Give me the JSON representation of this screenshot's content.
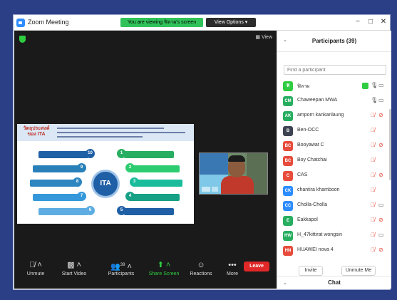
{
  "window": {
    "title": "Zoom Meeting",
    "share_banner": "You are viewing ฟิลาผ's screen",
    "view_options": "View Options",
    "minimize": "−",
    "maximize": "□",
    "close": "✕"
  },
  "video": {
    "view_label": "View",
    "slide_title": "วัตถุประสงค์ ของ ITA",
    "slide_center": "ITA",
    "slide_nodes": [
      "10",
      "1",
      "9",
      "2",
      "8",
      "3",
      "7",
      "4",
      "6",
      "5"
    ]
  },
  "toolbar": {
    "unmute": "Unmute",
    "start_video": "Start Video",
    "participants": "Participants",
    "participants_count": "39",
    "share_screen": "Share Screen",
    "reactions": "Reactions",
    "more": "More",
    "leave": "Leave"
  },
  "panel": {
    "title": "Participants (39)",
    "search_placeholder": "Find a participant",
    "invite": "Invite",
    "unmute_me": "Unmute Me",
    "chat": "Chat"
  },
  "participants": [
    {
      "initials": "ฟิ",
      "name": "ฟิลาผ",
      "color": "#2ecc40",
      "host": true,
      "mic": "on",
      "cam": "on"
    },
    {
      "initials": "CM",
      "name": "Chaweepan MWA",
      "color": "#27ae60",
      "host": false,
      "mic": "on",
      "cam": "on"
    },
    {
      "initials": "AK",
      "name": "amporn kankanlaung",
      "color": "#27ae60",
      "host": false,
      "mic": "muted",
      "cam": "off"
    },
    {
      "initials": "B",
      "name": "Ben-OCC",
      "color": "#3d4451",
      "host": false,
      "mic": "muted",
      "cam": "none"
    },
    {
      "initials": "BC",
      "name": "Booyawat C",
      "color": "#e74c3c",
      "host": false,
      "mic": "muted",
      "cam": "off"
    },
    {
      "initials": "BC",
      "name": "Boy Chatchai",
      "color": "#e74c3c",
      "host": false,
      "mic": "muted",
      "cam": "none"
    },
    {
      "initials": "C",
      "name": "CAS",
      "color": "#e74c3c",
      "host": false,
      "mic": "muted",
      "cam": "off"
    },
    {
      "initials": "CK",
      "name": "chantira khamboon",
      "color": "#2d8cff",
      "host": false,
      "mic": "muted",
      "cam": "none"
    },
    {
      "initials": "CC",
      "name": "Cholla-Cholla",
      "color": "#2d8cff",
      "host": false,
      "mic": "muted",
      "cam": "on"
    },
    {
      "initials": "E",
      "name": "Eakkapol",
      "color": "#27ae60",
      "host": false,
      "mic": "muted",
      "cam": "off"
    },
    {
      "initials": "HW",
      "name": "H_47kittirat wongsin",
      "color": "#27ae60",
      "host": false,
      "mic": "muted",
      "cam": "on"
    },
    {
      "initials": "HN",
      "name": "HUAWEI nova 4",
      "color": "#e74c3c",
      "host": false,
      "mic": "muted",
      "cam": "off"
    }
  ]
}
